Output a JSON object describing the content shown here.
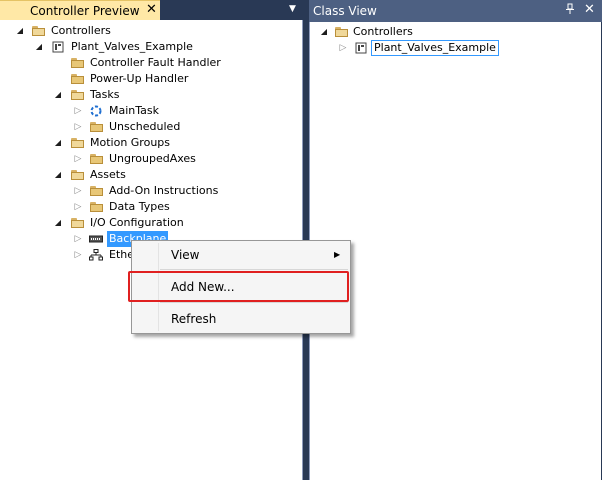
{
  "left_panel": {
    "tab_title": "Controller Preview",
    "close_glyph": "✕",
    "dropdown_glyph": "▼",
    "tree": [
      {
        "label": "Controllers",
        "icon": "folder-open-icon",
        "expanded": true
      },
      {
        "label": "Plant_Valves_Example",
        "icon": "controller-icon",
        "expanded": true
      },
      {
        "label": "Controller Fault Handler",
        "icon": "folder-icon"
      },
      {
        "label": "Power-Up Handler",
        "icon": "folder-icon"
      },
      {
        "label": "Tasks",
        "icon": "folder-open-icon",
        "expanded": true
      },
      {
        "label": "MainTask",
        "icon": "task-cycle-icon",
        "expanded": false
      },
      {
        "label": "Unscheduled",
        "icon": "folder-icon",
        "expanded": false
      },
      {
        "label": "Motion Groups",
        "icon": "folder-open-icon",
        "expanded": true
      },
      {
        "label": "UngroupedAxes",
        "icon": "folder-icon",
        "expanded": false
      },
      {
        "label": "Assets",
        "icon": "folder-open-icon",
        "expanded": true
      },
      {
        "label": "Add-On Instructions",
        "icon": "folder-icon",
        "expanded": false
      },
      {
        "label": "Data Types",
        "icon": "folder-icon",
        "expanded": false
      },
      {
        "label": "I/O Configuration",
        "icon": "folder-open-icon",
        "expanded": true
      },
      {
        "label": "Backplane",
        "icon": "backplane-icon",
        "expanded": false,
        "selected": true
      },
      {
        "label": "Ethe",
        "icon": "ethernet-network-icon",
        "expanded": false
      }
    ]
  },
  "right_panel": {
    "title": "Class View",
    "pin_glyph": "📌",
    "close_glyph": "✕",
    "tree": [
      {
        "label": "Controllers",
        "icon": "folder-open-icon",
        "expanded": true
      },
      {
        "label": "Plant_Valves_Example",
        "icon": "controller-icon",
        "expanded": false,
        "boxed": true
      }
    ]
  },
  "context_menu": {
    "items": [
      {
        "label": "View",
        "has_submenu": true
      },
      {
        "label": "Add New...",
        "highlighted_annotation": true
      },
      {
        "label": "Refresh"
      }
    ],
    "submenu_arrow": "▶"
  },
  "colors": {
    "chrome_dark": "#293955",
    "active_tab": "#ffe8a6",
    "right_header": "#4d6082",
    "selection": "#3399ff",
    "annotation_red": "#e02020"
  }
}
